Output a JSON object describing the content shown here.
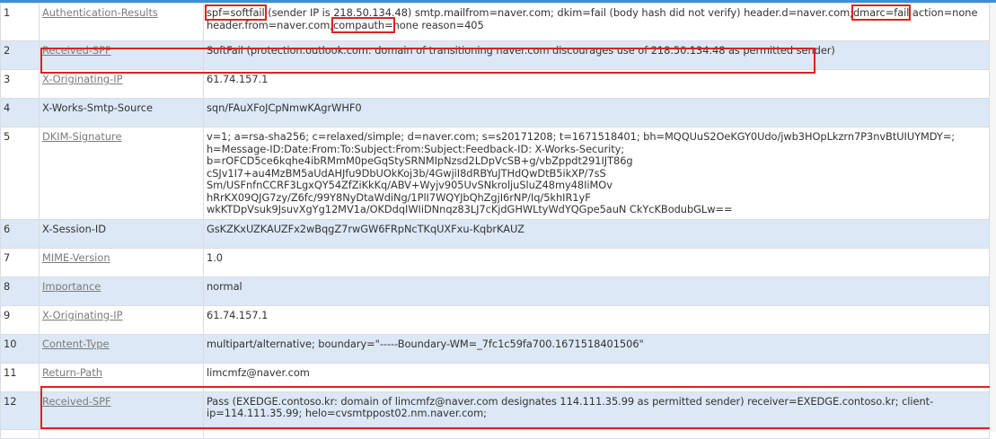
{
  "colors": {
    "accent": "#3c8fd6",
    "highlight": "#e02020",
    "row_alt": "#dce8f5",
    "link": "#7b7b7b"
  },
  "rows": [
    {
      "num": "1",
      "name": "Authentication-Results",
      "link": true,
      "segments": [
        {
          "t": "spf=softfail",
          "hl": true
        },
        {
          "t": " (sender IP is 218.50.134.48) smtp.mailfrom=naver.com; dkim=fail (body hash did not verify) header.d=naver.com;"
        },
        {
          "t": "dmarc=fail",
          "hl": true
        },
        {
          "t": " action=none header.from=naver.com;"
        },
        {
          "t": "compauth=",
          "hl": true
        },
        {
          "t": "none reason=405"
        }
      ]
    },
    {
      "num": "2",
      "name": "Received-SPF",
      "link": true,
      "value": "SoftFail (protection.outlook.com: domain of transitioning naver.com discourages use of 218.50.134.48 as permitted sender)"
    },
    {
      "num": "3",
      "name": "X-Originating-IP",
      "link": true,
      "value": "61.74.157.1"
    },
    {
      "num": "4",
      "name": "X-Works-Smtp-Source",
      "link": false,
      "value": "sqn/FAuXFoJCpNmwKAgrWHF0"
    },
    {
      "num": "5",
      "name": "DKIM-Signature",
      "link": true,
      "value": "v=1; a=rsa-sha256; c=relaxed/simple; d=naver.com; s=s20171208; t=1671518401; bh=MQQUuS2OeKGY0Udo/jwb3HOpLkzrn7P3nvBtUIUYMDY=; h=Message-ID:Date:From:To:Subject:From:Subject:Feedback-ID: X-Works-Security; b=rOFCD5ce6kqhe4ibRMmM0peGqStySRNMIpNzsd2LDpVcSB+g/vbZppdt291IJT86g cSJv1I7+au4MzBM5aUdAHJfu9DbUOkKoj3b/4GwjiI8dRBYuJTHdQwDtB5ikXP/7sS Sm/USFnfnCCRF3LgxQY54ZfZiKkKq/ABV+Wyjv905UvSNkroljuSluZ48my48IiMOv hRrKX09QJG7zy/Z6fc/99Y8NyDtaWdiNg/1PlI7WQYJbQhZgjI6rNP/Iq/5khIR1yF wkKTDpVsuk9JsuvXgYg12MV1a/OKDdqIWIiDNnqz83LJ7cKjdGHWLtyWdYQGpe5auN CkYcKBodubGLw=="
    },
    {
      "num": "6",
      "name": "X-Session-ID",
      "link": false,
      "value": "GsKZKxUZKAUZFx2wBqgZ7rwGW6FRpNcTKqUXFxu-KqbrKAUZ"
    },
    {
      "num": "7",
      "name": "MIME-Version",
      "link": true,
      "value": "1.0"
    },
    {
      "num": "8",
      "name": "Importance",
      "link": true,
      "value": "normal"
    },
    {
      "num": "9",
      "name": "X-Originating-IP",
      "link": true,
      "value": "61.74.157.1"
    },
    {
      "num": "10",
      "name": "Content-Type",
      "link": true,
      "value": "multipart/alternative; boundary=\"-----Boundary-WM=_7fc1c59fa700.1671518401506\""
    },
    {
      "num": "11",
      "name": "Return-Path",
      "link": true,
      "value": "limcmfz@naver.com"
    },
    {
      "num": "12",
      "name": "Received-SPF",
      "link": true,
      "value": "Pass (EXEDGE.contoso.kr: domain of limcmfz@naver.com designates 114.111.35.99 as permitted sender) receiver=EXEDGE.contoso.kr; client-ip=114.111.35.99; helo=cvsmtppost02.nm.naver.com;"
    },
    {
      "num": "",
      "name": "",
      "link": false,
      "value": ""
    }
  ]
}
